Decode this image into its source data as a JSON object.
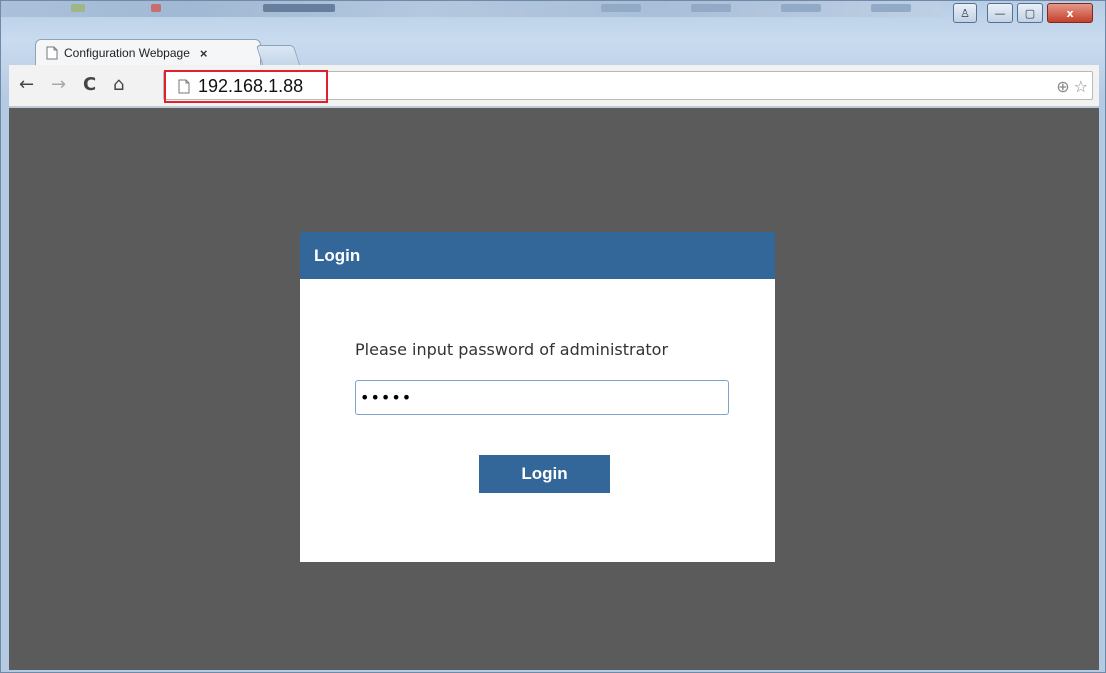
{
  "browser": {
    "tab": {
      "title": "Configuration Webpage",
      "close_glyph": "×"
    },
    "nav": {
      "back": "←",
      "forward": "→",
      "reload": "C",
      "home": "⌂"
    },
    "address": {
      "url": "192.168.1.88"
    },
    "window_controls": {
      "user": "♙",
      "minimize": "—",
      "maximize": "▢",
      "close": "x"
    },
    "icons": {
      "zoom": "⊕",
      "star": "☆",
      "menu": "≡"
    }
  },
  "login": {
    "header": "Login",
    "prompt": "Please input password of administrator",
    "password_value": "•••••",
    "button_label": "Login"
  },
  "colors": {
    "page_background": "#5b5b5b",
    "panel_header": "#336699",
    "button": "#336699",
    "url_highlight": "#e0202a"
  }
}
